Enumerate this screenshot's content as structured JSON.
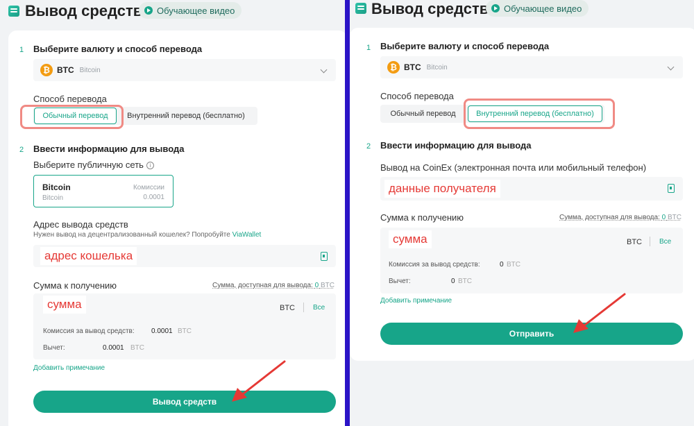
{
  "colors": {
    "accent": "#17a589",
    "highlight": "#f08a84",
    "annotation_red": "#e53935",
    "divider": "#2b14c7",
    "btc": "#f39c12"
  },
  "header": {
    "title": "Вывод средств",
    "video_label": "Обучающее видео"
  },
  "left": {
    "step1": {
      "num": "1",
      "label": "Выберите валюту и способ перевода"
    },
    "currency": {
      "code": "BTC",
      "name": "Bitcoin",
      "icon": "btc-icon"
    },
    "method_label": "Способ перевода",
    "methods": [
      "Обычный перевод",
      "Внутренний перевод (бесплатно)"
    ],
    "selected_method": 0,
    "step2": {
      "num": "2",
      "label": "Ввести информацию для вывода"
    },
    "network_label": "Выберите публичную сеть",
    "network": {
      "name": "Bitcoin",
      "sub": "Bitcoin",
      "fee_label": "Комиссии",
      "fee_value": "0.0001"
    },
    "address_label": "Адрес вывода средств",
    "address_hint": "Нужен вывод на децентрализованный кошелек? Попробуйте",
    "address_hint_link": "ViaWallet",
    "address_annotation": "адрес кошелька",
    "amount_label": "Сумма к получению",
    "available_label": "Сумма, доступная для вывода:",
    "available_value": "0",
    "available_unit": "BTC",
    "amount_annotation": "сумма",
    "amount_currency": "BTC",
    "amount_all": "Все",
    "fee_label": "Комиссия за вывод средств:",
    "fee_value": "0.0001",
    "fee_unit": "BTC",
    "deduct_label": "Вычет:",
    "deduct_value": "0.0001",
    "deduct_unit": "BTC",
    "add_note": "Добавить примечание",
    "submit": "Вывод средств"
  },
  "right": {
    "step1": {
      "num": "1",
      "label": "Выберите валюту и способ перевода"
    },
    "currency": {
      "code": "BTC",
      "name": "Bitcoin",
      "icon": "btc-icon"
    },
    "method_label": "Способ перевода",
    "methods": [
      "Обычный перевод",
      "Внутренний перевод (бесплатно)"
    ],
    "selected_method": 1,
    "step2": {
      "num": "2",
      "label": "Ввести информацию для вывода"
    },
    "recipient_label": "Вывод на CoinEx (электронная почта или мобильный телефон)",
    "recipient_annotation": "данные получателя",
    "amount_label": "Сумма к получению",
    "available_label": "Сумма, доступная для вывода:",
    "available_value": "0",
    "available_unit": "BTC",
    "amount_annotation": "сумма",
    "amount_currency": "BTC",
    "amount_all": "Все",
    "fee_label": "Комиссия за вывод средств:",
    "fee_value": "0",
    "fee_unit": "BTC",
    "deduct_label": "Вычет:",
    "deduct_value": "0",
    "deduct_unit": "BTC",
    "add_note": "Добавить примечание",
    "submit": "Отправить"
  }
}
